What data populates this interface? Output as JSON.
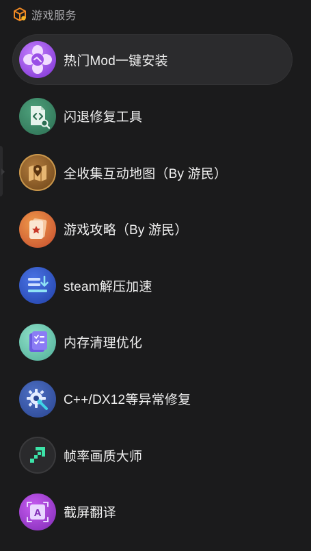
{
  "header": {
    "title": "游戏服务",
    "icon": "box-icon"
  },
  "items": [
    {
      "label": "热门Mod一键安装",
      "icon": "mod-flower-icon",
      "color": "#9b4dde",
      "active": true
    },
    {
      "label": "闪退修复工具",
      "icon": "code-file-icon",
      "color": "#3f8a6a",
      "active": false
    },
    {
      "label": "全收集互动地图（By 游民）",
      "icon": "map-pin-icon",
      "color": "#8a5a28",
      "active": false
    },
    {
      "label": "游戏攻略（By 游民）",
      "icon": "guide-book-icon",
      "color": "#d9683a",
      "active": false
    },
    {
      "label": "steam解压加速",
      "icon": "download-list-icon",
      "color": "#2f54c8",
      "active": false
    },
    {
      "label": "内存清理优化",
      "icon": "checklist-icon",
      "color": "#4fb5a4",
      "active": false
    },
    {
      "label": "C++/DX12等异常修复",
      "icon": "gear-wrench-icon",
      "color": "#3a57a8",
      "active": false
    },
    {
      "label": "帧率画质大师",
      "icon": "pixel-arrow-icon",
      "color": "#2a2a2c",
      "active": false
    },
    {
      "label": "截屏翻译",
      "icon": "translate-a-icon",
      "color": "#9f3fc7",
      "active": false
    }
  ]
}
